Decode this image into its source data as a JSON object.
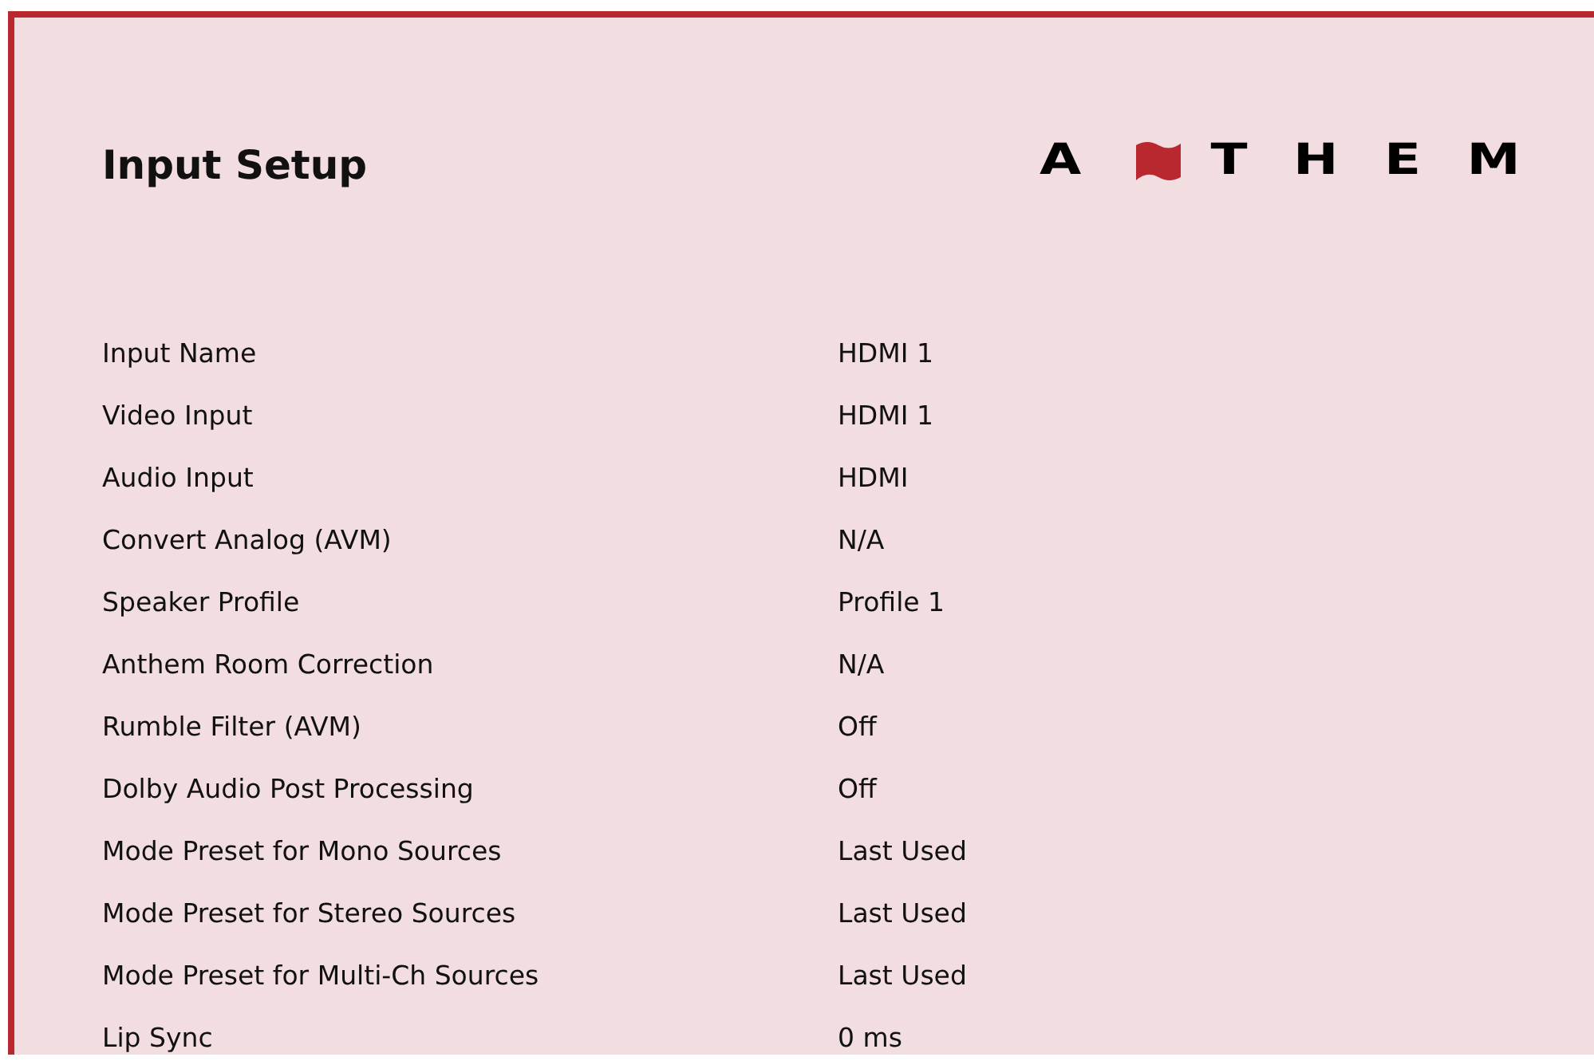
{
  "title": "Input Setup",
  "logo": {
    "before": "A",
    "after": "THEM"
  },
  "rows": [
    {
      "label": "Input Name",
      "value": "HDMI 1"
    },
    {
      "label": "Video Input",
      "value": "HDMI 1"
    },
    {
      "label": "Audio Input",
      "value": "HDMI"
    },
    {
      "label": "Convert Analog (AVM)",
      "value": "N/A"
    },
    {
      "label": "Speaker Profile",
      "value": "Profile 1"
    },
    {
      "label": "Anthem Room Correction",
      "value": "N/A"
    },
    {
      "label": "Rumble Filter (AVM)",
      "value": "Off"
    },
    {
      "label": "Dolby Audio Post Processing",
      "value": "Off"
    },
    {
      "label": "Mode Preset for Mono Sources",
      "value": "Last Used"
    },
    {
      "label": "Mode Preset for Stereo Sources",
      "value": "Last Used"
    },
    {
      "label": "Mode Preset for Multi-Ch Sources",
      "value": "Last Used"
    },
    {
      "label": "Lip Sync",
      "value": "0 ms"
    }
  ]
}
